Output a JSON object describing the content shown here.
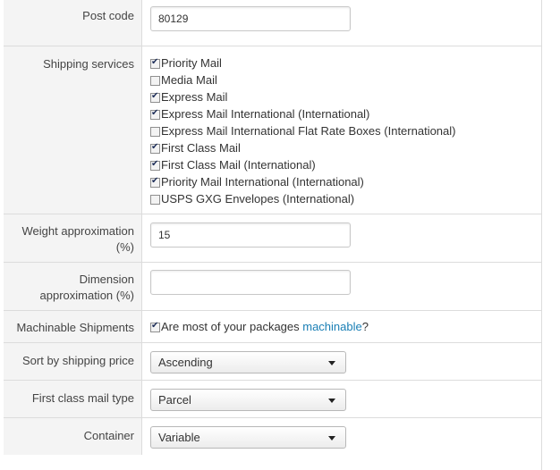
{
  "postcode": {
    "label": "Post code",
    "value": "80129"
  },
  "shipping_services": {
    "label": "Shipping services",
    "items": [
      {
        "label": "Priority Mail",
        "checked": true
      },
      {
        "label": "Media Mail",
        "checked": false
      },
      {
        "label": "Express Mail",
        "checked": true
      },
      {
        "label": "Express Mail International (International)",
        "checked": true
      },
      {
        "label": "Express Mail International Flat Rate Boxes (International)",
        "checked": false
      },
      {
        "label": "First Class Mail",
        "checked": true
      },
      {
        "label": "First Class Mail (International)",
        "checked": true
      },
      {
        "label": "Priority Mail International (International)",
        "checked": true
      },
      {
        "label": "USPS GXG Envelopes (International)",
        "checked": false
      }
    ]
  },
  "weight_approx": {
    "label_line1": "Weight approximation",
    "label_line2": "(%)",
    "value": "15"
  },
  "dimension_approx": {
    "label_line1": "Dimension",
    "label_line2": "approximation (%)",
    "value": ""
  },
  "machinable": {
    "label": "Machinable Shipments",
    "checked": true,
    "text_before": "Are most of your packages ",
    "link_text": "machinable",
    "text_after": "?"
  },
  "sort_price": {
    "label": "Sort by shipping price",
    "selected": "Ascending"
  },
  "first_class_type": {
    "label": "First class mail type",
    "selected": "Parcel"
  },
  "container": {
    "label": "Container",
    "selected": "Variable"
  }
}
